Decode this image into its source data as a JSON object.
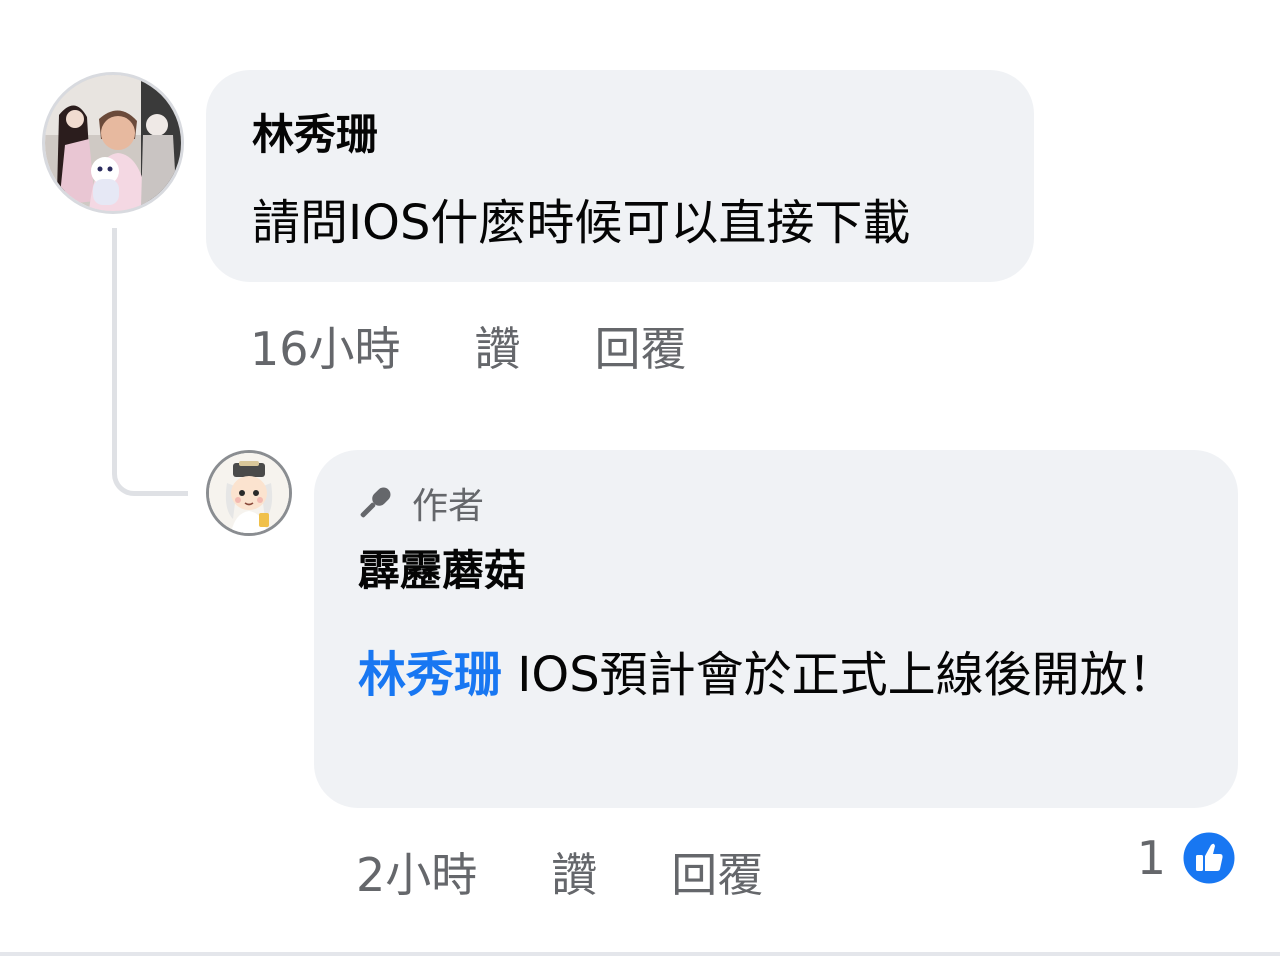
{
  "comment": {
    "author": "林秀珊",
    "text": "請問IOS什麼時候可以直接下載",
    "timestamp": "16小時",
    "like_label": "讚",
    "reply_label": "回覆",
    "avatar_icon": "user-photo-avatar"
  },
  "reply": {
    "badge_label": "作者",
    "badge_icon": "microphone-icon",
    "author": "霹靂蘑菇",
    "mention": "林秀珊",
    "text": " IOS預計會於正式上線後開放！",
    "timestamp": "2小時",
    "like_label": "讚",
    "reply_label": "回覆",
    "reaction_count": "1",
    "reaction_icon": "like-thumb-icon",
    "avatar_icon": "cartoon-avatar"
  },
  "colors": {
    "bubble_bg": "#f0f2f5",
    "mention": "#1877f2",
    "meta_text": "#65676b",
    "like_badge": "#1877f2"
  }
}
